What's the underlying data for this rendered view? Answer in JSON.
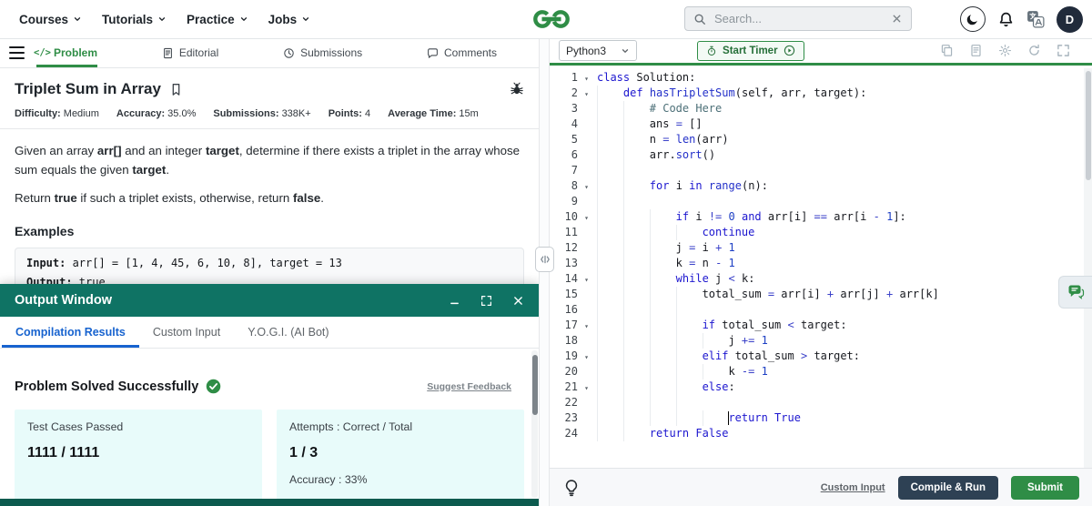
{
  "colors": {
    "brand_green": "#2f8d46",
    "output_header_teal": "#0f7364",
    "active_tab_blue": "#1763cf",
    "compile_button_navy": "#2e4154",
    "result_card_bg": "#e8fbfa",
    "code_keyword_blue": "#1c16cf"
  },
  "topnav": {
    "items": [
      {
        "label": "Courses"
      },
      {
        "label": "Tutorials"
      },
      {
        "label": "Practice"
      },
      {
        "label": "Jobs"
      }
    ],
    "search_placeholder": "Search...",
    "avatar_initial": "D"
  },
  "left_tabs": {
    "items": [
      {
        "label": "Problem",
        "icon": "code",
        "active": true
      },
      {
        "label": "Editorial",
        "icon": "doc",
        "active": false
      },
      {
        "label": "Submissions",
        "icon": "clock",
        "active": false
      },
      {
        "label": "Comments",
        "icon": "comment",
        "active": false
      }
    ]
  },
  "problem": {
    "title": "Triplet Sum in Array",
    "meta": [
      {
        "label": "Difficulty:",
        "value": "Medium"
      },
      {
        "label": "Accuracy:",
        "value": "35.0%"
      },
      {
        "label": "Submissions:",
        "value": "338K+"
      },
      {
        "label": "Points:",
        "value": "4"
      },
      {
        "label": "Average Time:",
        "value": "15m"
      }
    ],
    "statement": [
      [
        {
          "t": "Given an array "
        },
        {
          "t": "arr[]",
          "b": true
        },
        {
          "t": " and an integer "
        },
        {
          "t": "target",
          "b": true
        },
        {
          "t": ", determine if there exists a triplet in the array whose sum equals the given "
        },
        {
          "t": "target",
          "b": true
        },
        {
          "t": "."
        }
      ],
      [
        {
          "t": "Return "
        },
        {
          "t": "true",
          "b": true
        },
        {
          "t": " if such a triplet exists, otherwise, return "
        },
        {
          "t": "false",
          "b": true
        },
        {
          "t": "."
        }
      ]
    ],
    "examples_heading": "Examples",
    "example": {
      "input": [
        {
          "t": "Input: ",
          "b": true
        },
        {
          "t": "arr[] = [1, 4, 45, 6, 10, 8], target = 13"
        }
      ],
      "output": [
        {
          "t": "Output: ",
          "b": true
        },
        {
          "t": "true"
        }
      ]
    }
  },
  "output_window": {
    "title": "Output Window",
    "tabs": [
      {
        "label": "Compilation Results",
        "active": true
      },
      {
        "label": "Custom Input",
        "active": false
      },
      {
        "label": "Y.O.G.I. (AI Bot)",
        "active": false
      }
    ],
    "status": "Problem Solved Successfully",
    "suggest_feedback": "Suggest Feedback",
    "cards": [
      {
        "label": "Test Cases Passed",
        "value": "1111 / 1111"
      },
      {
        "label": "Attempts : Correct / Total",
        "value": "1 / 3",
        "extra": "Accuracy : 33%"
      }
    ]
  },
  "editor": {
    "language": "Python3",
    "start_timer_label": "Start Timer",
    "cursor": {
      "line": 23,
      "col": 20
    },
    "fold_lines": [
      1,
      2,
      8,
      10,
      14,
      17,
      19,
      21
    ],
    "lines": [
      "class Solution:",
      "    def hasTripletSum(self, arr, target):",
      "        # Code Here",
      "        ans = []",
      "        n = len(arr)",
      "        arr.sort()",
      "",
      "        for i in range(n):",
      "",
      "            if i != 0 and arr[i] == arr[i - 1]:",
      "                continue",
      "            j = i + 1",
      "            k = n - 1",
      "            while j < k:",
      "                total_sum = arr[i] + arr[j] + arr[k]",
      "",
      "                if total_sum < target:",
      "                    j += 1",
      "                elif total_sum > target:",
      "                    k -= 1",
      "                else:",
      "",
      "                    return True",
      "        return False"
    ]
  },
  "editor_footer": {
    "custom_input": "Custom Input",
    "compile_run": "Compile & Run",
    "submit": "Submit"
  }
}
